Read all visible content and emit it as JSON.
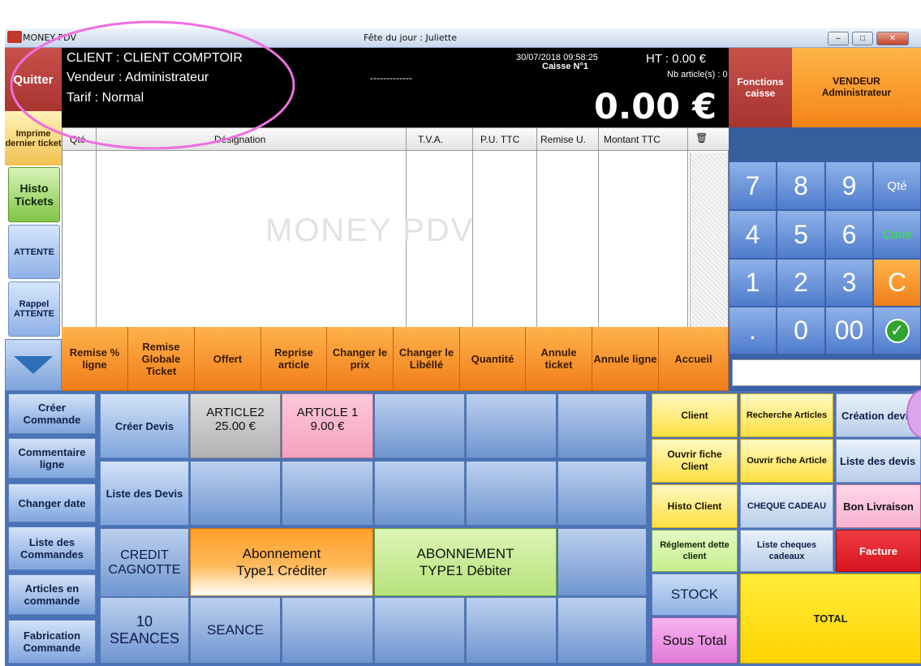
{
  "window": {
    "app_title": "MONEY PDV",
    "fete": "Fête du jour : Juliette",
    "min": "–",
    "max": "□",
    "close": "✕"
  },
  "header": {
    "quit": "Quitter",
    "client": "CLIENT : CLIENT COMPTOIR",
    "vendeur": "Vendeur : Administrateur",
    "tarif": "Tarif : Normal",
    "datetime": "30/07/2018 09:58:25",
    "caisse": "Caisse N°1",
    "dashes": "-------------",
    "ht": "HT : 0.00 €",
    "nb": "Nb article(s) : 0",
    "total": "0.00 €",
    "fonctions": "Fonctions caisse",
    "vendeur_btn_1": "VENDEUR",
    "vendeur_btn_2": "Administrateur"
  },
  "left": {
    "print": "Imprime dernier ticket",
    "histo": "Histo Tickets",
    "attente": "ATTENTE",
    "rappel": "Rappel ATTENTE"
  },
  "table": {
    "columns": [
      "Qté",
      "Désignation",
      "T.V.A.",
      "P.U. TTC",
      "Remise U.",
      "Montant TTC"
    ],
    "watermark": "MONEY PDV"
  },
  "actions": [
    "Remise % ligne",
    "Remise Globale Ticket",
    "Offert",
    "Reprise article",
    "Changer le prix",
    "Changer le Libéllé",
    "Quantité",
    "Annule ticket",
    "Annule ligne",
    "Accueil"
  ],
  "keypad": {
    "row1": [
      "7",
      "8",
      "9",
      "Qté"
    ],
    "row2": [
      "4",
      "5",
      "6",
      "Code"
    ],
    "row3": [
      "1",
      "2",
      "3",
      "C"
    ],
    "row4": [
      ".",
      "0",
      "00",
      "✓"
    ]
  },
  "bottom_left": {
    "col1": [
      "Créer Commande",
      "Commentaire ligne",
      "Changer date",
      "Liste des Commandes",
      "Articles en commande",
      "Fabrication Commande"
    ],
    "creer_devis": "Créer Devis",
    "liste_devis": "Liste des Devis",
    "credit": "CREDIT CAGNOTTE",
    "seances": "10 SEANCES",
    "seance": "SEANCE"
  },
  "products": {
    "article2_name": "ARTICLE2",
    "article2_price": "25.00 €",
    "article1_name": "ARTICLE 1",
    "article1_price": "9.00 €",
    "abo1": "Abonnement Type1 Créditer",
    "abo2": "ABONNEMENT TYPE1 Débiter"
  },
  "right_panel": {
    "client": "Client",
    "ouvrir_client": "Ouvrir fiche Client",
    "histo_client": "Histo Client",
    "reglement": "Réglement dette client",
    "stock": "STOCK",
    "sous_total": "Sous Total",
    "recherche": "Recherche Articles",
    "ouvrir_article": "Ouvrir fiche Article",
    "cheque": "CHEQUE CADEAU",
    "liste_cheques": "Liste cheques cadeaux",
    "creation_devis": "Création devis",
    "liste_devis": "Liste des devis",
    "bon_livraison": "Bon Livraison",
    "facture": "Facture",
    "total": "TOTAL"
  },
  "colors": {
    "orange": "#f5891f",
    "annotation": "#ee6fe0",
    "green": "#c6ef8e",
    "red": "#e4222b"
  }
}
